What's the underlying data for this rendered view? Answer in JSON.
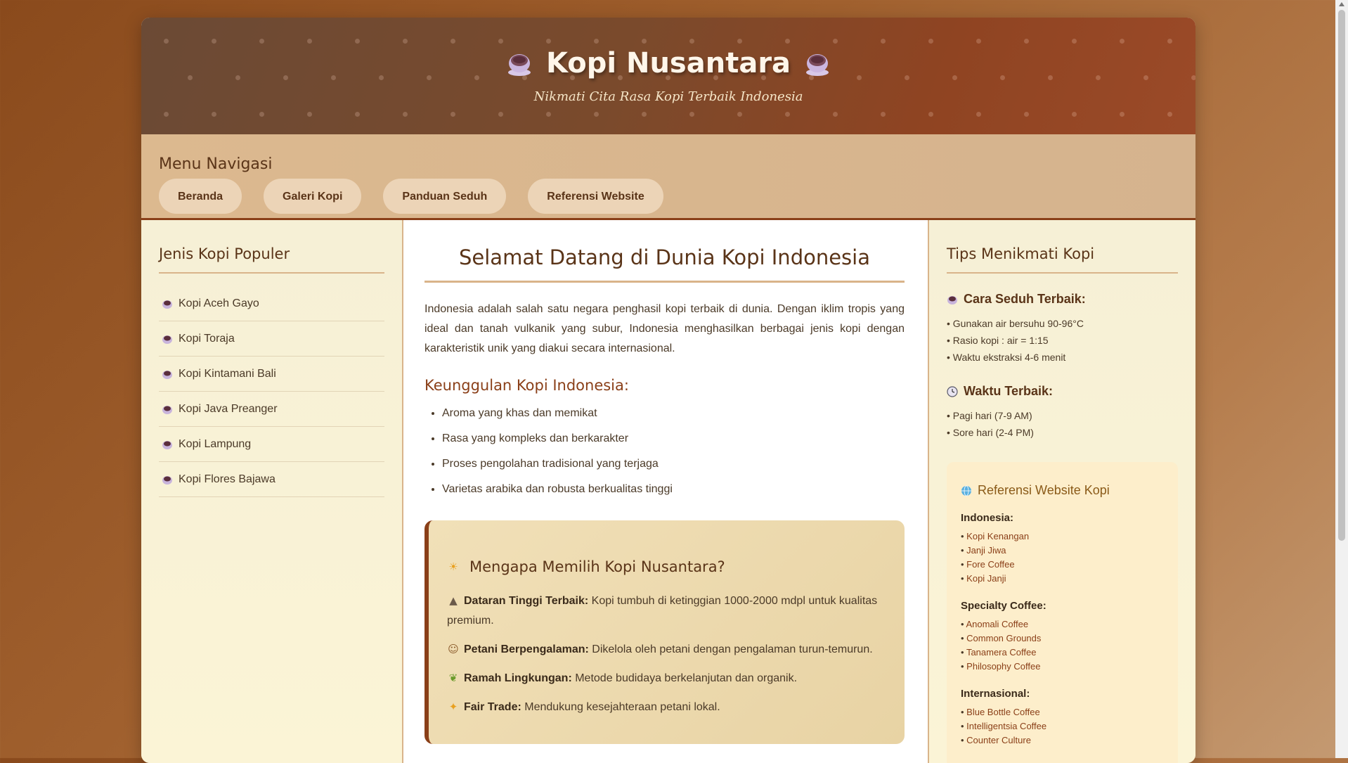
{
  "header": {
    "title": "Kopi Nusantara",
    "subtitle": "Nikmati Cita Rasa Kopi Terbaik Indonesia"
  },
  "nav": {
    "heading": "Menu Navigasi",
    "items": [
      {
        "label": "Beranda"
      },
      {
        "label": "Galeri Kopi"
      },
      {
        "label": "Panduan Seduh"
      },
      {
        "label": "Referensi Website"
      }
    ]
  },
  "left": {
    "heading": "Jenis Kopi Populer",
    "items": [
      {
        "label": "Kopi Aceh Gayo"
      },
      {
        "label": "Kopi Toraja"
      },
      {
        "label": "Kopi Kintamani Bali"
      },
      {
        "label": "Kopi Java Preanger"
      },
      {
        "label": "Kopi Lampung"
      },
      {
        "label": "Kopi Flores Bajawa"
      }
    ]
  },
  "main": {
    "title": "Selamat Datang di Dunia Kopi Indonesia",
    "intro": "Indonesia adalah salah satu negara penghasil kopi terbaik di dunia. Dengan iklim tropis yang ideal dan tanah vulkanik yang subur, Indonesia menghasilkan berbagai jenis kopi dengan karakteristik unik yang diakui secara internasional.",
    "advantages_heading": "Keunggulan Kopi Indonesia:",
    "advantages": [
      "Aroma yang khas dan memikat",
      "Rasa yang kompleks dan berkarakter",
      "Proses pengolahan tradisional yang terjaga",
      "Varietas arabika dan robusta berkualitas tinggi"
    ],
    "why": {
      "heading": "Mengapa Memilih Kopi Nusantara?",
      "points": [
        {
          "title": "Dataran Tinggi Terbaik:",
          "text": " Kopi tumbuh di ketinggian 1000-2000 mdpl untuk kualitas premium."
        },
        {
          "title": "Petani Berpengalaman:",
          "text": " Dikelola oleh petani dengan pengalaman turun-temurun."
        },
        {
          "title": "Ramah Lingkungan:",
          "text": " Metode budidaya berkelanjutan dan organik."
        },
        {
          "title": "Fair Trade:",
          "text": " Mendukung kesejahteraan petani lokal."
        }
      ]
    }
  },
  "right": {
    "heading": "Tips Menikmati Kopi",
    "brew": {
      "heading": "Cara Seduh Terbaik:",
      "lines": [
        "• Gunakan air bersuhu 90-96°C",
        "• Rasio kopi : air = 1:15",
        "• Waktu ekstraksi 4-6 menit"
      ]
    },
    "time": {
      "heading": "Waktu Terbaik:",
      "lines": [
        "• Pagi hari (7-9 AM)",
        "• Sore hari (2-4 PM)"
      ]
    },
    "refs": {
      "heading": "Referensi Website Kopi",
      "groups": [
        {
          "name": "Indonesia:",
          "links": [
            "Kopi Kenangan",
            "Janji Jiwa",
            "Fore Coffee",
            "Kopi Janji"
          ]
        },
        {
          "name": "Specialty Coffee:",
          "links": [
            "Anomali Coffee",
            "Common Grounds",
            "Tanamera Coffee",
            "Philosophy Coffee"
          ]
        },
        {
          "name": "Internasional:",
          "links": [
            "Blue Bottle Coffee",
            "Intelligentsia Coffee",
            "Counter Culture"
          ]
        }
      ]
    }
  },
  "colors": {
    "accent": "#8a3f18",
    "brown_text": "#5a3418",
    "header_start": "#6b4a35",
    "header_end": "#9b4a28"
  },
  "icons": {
    "cup": "coffee-cup-icon",
    "sun": "sun-icon",
    "mountain": "mountain-icon",
    "farmer": "farmer-icon",
    "leaf": "leaf-icon",
    "sparkle": "sparkle-icon",
    "clock": "clock-icon",
    "globe": "globe-icon"
  }
}
